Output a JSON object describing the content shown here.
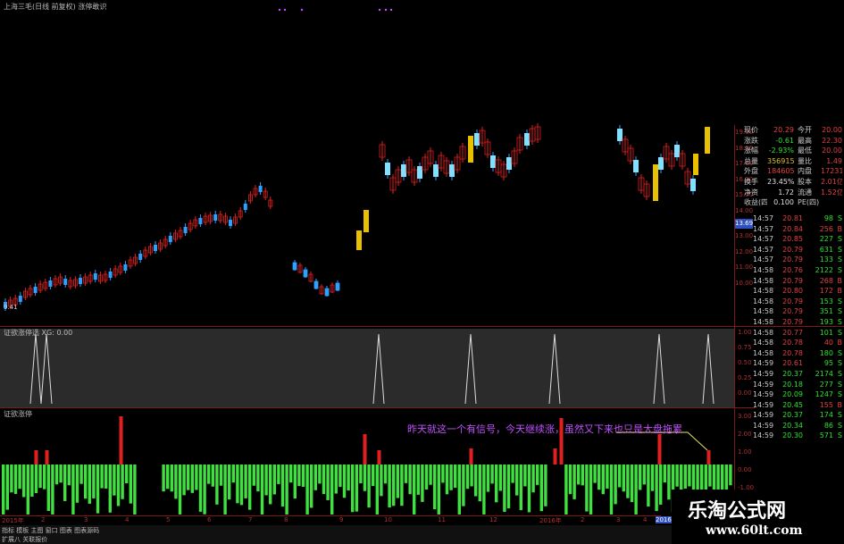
{
  "window": {
    "title": "上海三毛(日线 前复权) 涨停敢识"
  },
  "main_chart": {
    "price_low_label": "9.41"
  },
  "price_scale": [
    "19.00",
    "18.00",
    "17.00",
    "16.00",
    "15.00",
    "14.00",
    "13.69",
    "13.00",
    "12.00",
    "11.00",
    "10.00"
  ],
  "indicator1": {
    "label": "证欲涨停选 XG: 0.00",
    "scale": [
      "1.00",
      "0.75",
      "0.50",
      "0.25",
      "0.00"
    ]
  },
  "indicator2": {
    "label": "证欲涨停",
    "scale": [
      "3.00",
      "2.00",
      "1.00",
      "0.00",
      "-1.00"
    ]
  },
  "annotation": "昨天就这一个有信号，今天继续涨，虽然又下来也只是大盘拖累",
  "x_axis": {
    "labels": [
      "2015年",
      "2",
      "3",
      "4",
      "5",
      "6",
      "7",
      "8",
      "9",
      "10",
      "11",
      "12",
      "2016年",
      "2",
      "3",
      "4",
      "2016/0"
    ]
  },
  "quote_panel": {
    "rows": [
      {
        "l1": "现价",
        "v1": "20.29",
        "l2": "今开",
        "v2": "20.00"
      },
      {
        "l1": "涨跌",
        "v1": "-0.61",
        "l2": "最高",
        "v2": "22.30"
      },
      {
        "l1": "涨幅",
        "v1": "-2.93%",
        "l2": "最低",
        "v2": "20.00"
      },
      {
        "l1": "总量",
        "v1": "356915",
        "l2": "量比",
        "v2": "1.49"
      },
      {
        "l1": "外盘",
        "v1": "184605",
        "l2": "内盘",
        "v2": "172310"
      },
      {
        "l1": "换手",
        "v1": "23.45%",
        "l2": "股本",
        "v2": "2.01亿"
      },
      {
        "l1": "净资",
        "v1": "1.72",
        "l2": "流通",
        "v2": "1.52亿"
      },
      {
        "l1": "收益(四)",
        "v1": "0.100",
        "l2": "PE(四)",
        "v2": ""
      }
    ]
  },
  "tick_list": [
    {
      "time": "14:57",
      "price": "20.81",
      "vol": "98",
      "dir": "S"
    },
    {
      "time": "14:57",
      "price": "20.84",
      "vol": "256",
      "dir": "B"
    },
    {
      "time": "14:57",
      "price": "20.85",
      "vol": "227",
      "dir": "S"
    },
    {
      "time": "14:57",
      "price": "20.79",
      "vol": "631",
      "dir": "S"
    },
    {
      "time": "14:57",
      "price": "20.79",
      "vol": "133",
      "dir": "S"
    },
    {
      "time": "14:58",
      "price": "20.76",
      "vol": "2122",
      "dir": "S"
    },
    {
      "time": "14:58",
      "price": "20.79",
      "vol": "268",
      "dir": "B"
    },
    {
      "time": "14:58",
      "price": "20.80",
      "vol": "172",
      "dir": "B"
    },
    {
      "time": "14:58",
      "price": "20.79",
      "vol": "153",
      "dir": "S"
    },
    {
      "time": "14:58",
      "price": "20.79",
      "vol": "351",
      "dir": "S"
    },
    {
      "time": "14:58",
      "price": "20.79",
      "vol": "193",
      "dir": "S"
    },
    {
      "time": "14:58",
      "price": "20.77",
      "vol": "101",
      "dir": "S"
    },
    {
      "time": "14:58",
      "price": "20.78",
      "vol": "40",
      "dir": "B"
    },
    {
      "time": "14:58",
      "price": "20.78",
      "vol": "180",
      "dir": "S"
    },
    {
      "time": "14:59",
      "price": "20.61",
      "vol": "95",
      "dir": "S"
    },
    {
      "time": "14:59",
      "price": "20.37",
      "vol": "2174",
      "dir": "S"
    },
    {
      "time": "14:59",
      "price": "20.18",
      "vol": "277",
      "dir": "S"
    },
    {
      "time": "14:59",
      "price": "20.09",
      "vol": "1247",
      "dir": "S"
    },
    {
      "time": "14:59",
      "price": "20.45",
      "vol": "155",
      "dir": "B"
    },
    {
      "time": "14:59",
      "price": "20.37",
      "vol": "174",
      "dir": "S"
    },
    {
      "time": "14:59",
      "price": "20.34",
      "vol": "86",
      "dir": "S"
    },
    {
      "time": "14:59",
      "price": "20.30",
      "vol": "571",
      "dir": "S"
    }
  ],
  "bottom_bar": {
    "line1": "指标 模板 主图 窗口 图表 图表源码",
    "line2": "扩展八 关联报价"
  },
  "watermark": {
    "line1": "乐淘公式网",
    "line2": "www.60lt.com"
  },
  "colors": {
    "up": "#e02020",
    "down": "#30a0ff",
    "signal_yellow": "#e8c000",
    "green_bar": "#40e040",
    "red_bar": "#e02020",
    "annotation": "#c050ff"
  }
}
